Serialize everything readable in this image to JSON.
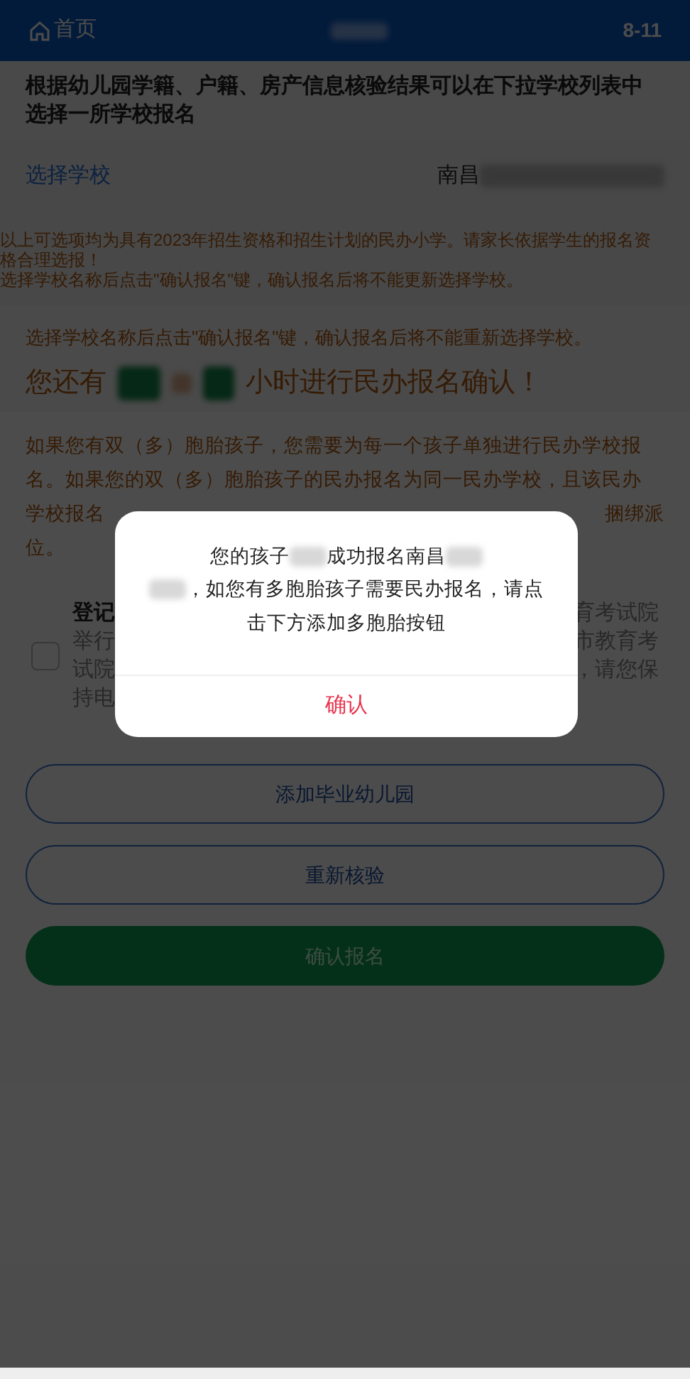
{
  "header": {
    "home_label": "首页",
    "right_text": "8-11"
  },
  "intro": "根据幼儿园学籍、户籍、房产信息核验结果可以在下拉学校列表中选择一所学校报名",
  "select_school": {
    "label": "选择学校",
    "value": "南昌"
  },
  "notice_lines": [
    "以上可选项均为具有2023年招生资格和招生计划的民办小学。请家长依据学生的报名资格合理选报！",
    "选择学校名称后点击\"确认报名\"键，确认报名后将不能更新选择学校。"
  ],
  "notice_repeat": "选择学校名称后点击\"确认报名\"键，确认报名后将不能重新选择学校。",
  "countdown": {
    "prefix": "您还有",
    "suffix": "小时进行民办报名确认！"
  },
  "twins_lines": [
    {
      "left": "如果您有双（多）胞胎孩子，您需要为每一个孩子单独进行民办学校报"
    },
    {
      "left": "名。如果您的双（多）胞胎孩子的民办报名为同一民办学校，且该民办"
    },
    {
      "left": "学校报名",
      "right": "捆绑派"
    },
    {
      "left": "位。"
    }
  ],
  "agreement": {
    "checked": false,
    "lines": [
      {
        "left": "登记",
        "right": "育考试院"
      },
      {
        "left": "举行",
        "right": "市教育考"
      },
      {
        "left": "试院",
        "right": "，请您保"
      },
      {
        "left": "持电"
      }
    ]
  },
  "buttons": [
    {
      "label": "添加毕业幼儿园",
      "kind": "outline"
    },
    {
      "label": "重新核验",
      "kind": "outline"
    },
    {
      "label": "确认报名",
      "kind": "primary"
    }
  ],
  "dialog": {
    "message_lines": [
      [
        {
          "kind": "text",
          "text": "您的孩子"
        },
        {
          "kind": "redacted"
        },
        {
          "kind": "text",
          "text": "成功报名南昌"
        },
        {
          "kind": "redacted"
        }
      ],
      [
        {
          "kind": "redacted"
        },
        {
          "kind": "text",
          "text": "，如您有多胞胎孩子需要民办报名，请点"
        }
      ],
      [
        {
          "kind": "text",
          "text": "击下方添加多胞胎按钮"
        }
      ]
    ],
    "confirm": "确认"
  }
}
